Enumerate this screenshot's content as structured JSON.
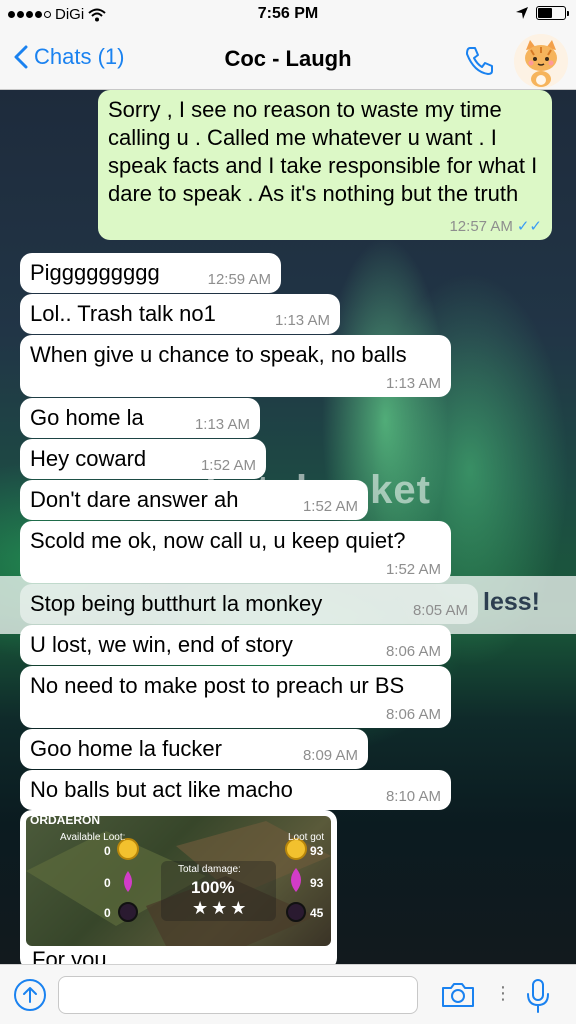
{
  "status_bar": {
    "carrier": "DiGi",
    "time": "7:56 PM"
  },
  "header": {
    "back_label": "Chats (1)",
    "title": "Coc - Laugh"
  },
  "wallpaper": {
    "watermark": "photobucket",
    "banner_fragment": "less!"
  },
  "messages": [
    {
      "text": "Sorry , I see no reason to waste my time calling u . Called me whatever u want . I speak facts and I take responsible for what I dare to speak . As it's nothing but the truth",
      "time": "12:57 AM",
      "direction": "outgoing",
      "read": true
    },
    {
      "text": "Piggggggggg",
      "time": "12:59 AM"
    },
    {
      "text": "Lol.. Trash talk no1",
      "time": "1:13 AM"
    },
    {
      "text": "When give u chance to speak, no balls",
      "time": "1:13 AM"
    },
    {
      "text": "Go home la",
      "time": "1:13 AM"
    },
    {
      "text": "Hey coward",
      "time": "1:52 AM"
    },
    {
      "text": "Don't dare answer ah",
      "time": "1:52 AM"
    },
    {
      "text": "Scold me ok, now call u, u keep quiet?",
      "time": "1:52 AM"
    },
    {
      "text": "Stop being butthurt la monkey",
      "time": "8:05 AM"
    },
    {
      "text": "U lost, we win, end of story",
      "time": "8:06 AM"
    },
    {
      "text": "No need to make post to preach ur BS",
      "time": "8:06 AM"
    },
    {
      "text": "Goo home la fucker",
      "time": "8:09 AM"
    },
    {
      "text": "No balls but act like macho",
      "time": "8:10 AM"
    }
  ],
  "image_message": {
    "caption": "For you",
    "screenshot": {
      "village_name": "ORDAERON",
      "available_loot_label": "Available Loot:",
      "loot_got_label": "Loot got",
      "total_damage_label": "Total damage:",
      "total_damage": "100%",
      "available_values": [
        "0",
        "0",
        "0"
      ],
      "got_values": [
        "93",
        "93",
        "45"
      ]
    }
  },
  "colors": {
    "accent": "#1a82f0",
    "outgoing_bubble": "#dcf8c6",
    "incoming_bubble": "#ffffff",
    "read_ticks": "#3a9bf4"
  },
  "icons": [
    "signal-dots-icon",
    "wifi-icon",
    "location-arrow-icon",
    "battery-icon",
    "back-chevron-icon",
    "phone-icon",
    "cat-avatar",
    "share-icon",
    "camera-icon",
    "microphone-icon"
  ]
}
